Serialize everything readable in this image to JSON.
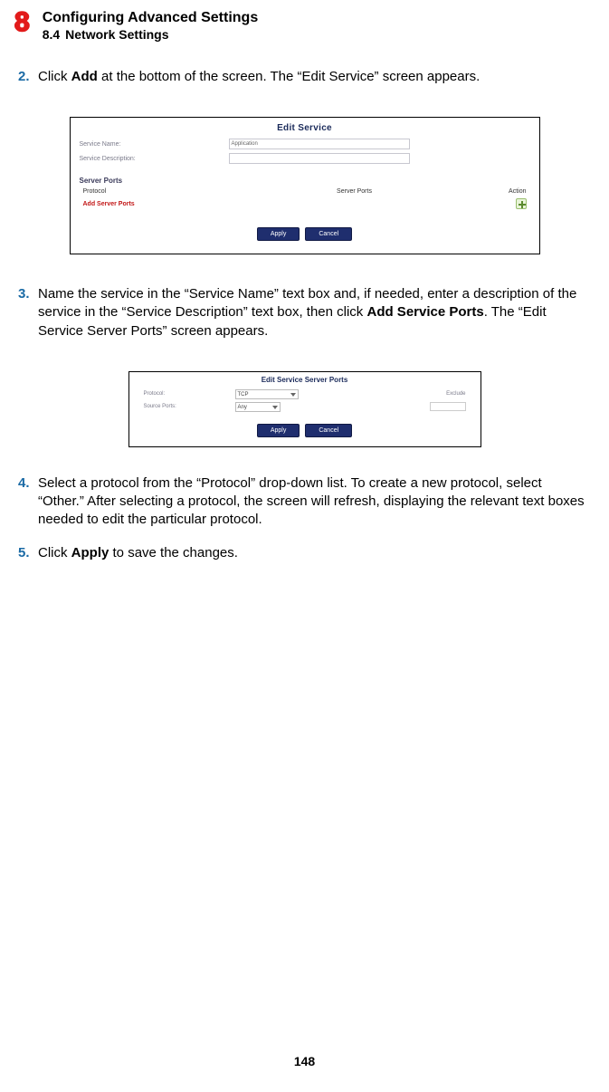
{
  "header": {
    "chapter_number": "8",
    "chapter_title": "Configuring Advanced Settings",
    "section_number": "8.4",
    "section_title": "Network Settings"
  },
  "steps": {
    "s2": {
      "num": "2.",
      "t1": "Click ",
      "b1": "Add",
      "t2": " at the bottom of the screen. The “Edit Service” screen appears."
    },
    "s3": {
      "num": "3.",
      "t1": "Name the service in the “Service Name” text box and, if needed, enter a description of the service in the “Service Description” text box, then click ",
      "b1": "Add Service Ports",
      "t2": ". The “Edit Service Server Ports” screen appears."
    },
    "s4": {
      "num": "4.",
      "t1": "Select a protocol from the “Protocol” drop-down list. To create a new protocol, select “Other.” After selecting a protocol, the screen will refresh, displaying the relevant text boxes needed to edit the particular protocol."
    },
    "s5": {
      "num": "5.",
      "t1": "Click ",
      "b1": "Apply",
      "t2": " to save the changes."
    }
  },
  "fig1": {
    "title": "Edit Service",
    "label_name": "Service Name:",
    "input_name_value": "Application",
    "label_desc": "Service Description:",
    "sub": "Server Ports",
    "col1": "Protocol",
    "col2": "Server Ports",
    "col3": "Action",
    "addlink": "Add Server Ports",
    "btn_apply": "Apply",
    "btn_cancel": "Cancel"
  },
  "fig2": {
    "title": "Edit Service Server Ports",
    "label_protocol": "Protocol:",
    "select_value": "TCP",
    "right_label": "Exclude",
    "label_source": "Source Ports:",
    "sel_any": "Any",
    "btn_apply": "Apply",
    "btn_cancel": "Cancel"
  },
  "page_number": "148"
}
